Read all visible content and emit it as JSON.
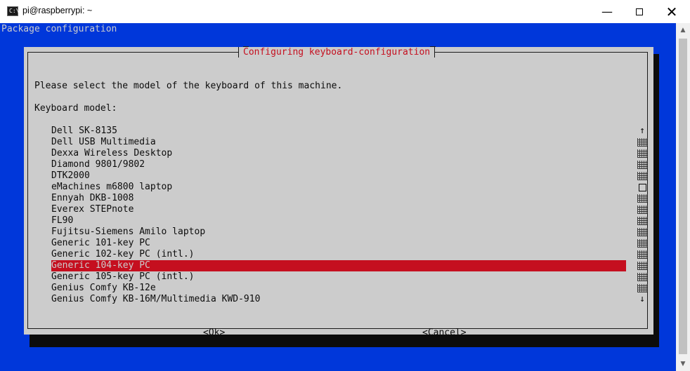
{
  "window": {
    "title": "pi@raspberrypi: ~",
    "app_icon_text": "C:\\",
    "buttons": {
      "minimize": "—",
      "close": "✕"
    }
  },
  "terminal": {
    "backtitle": "Package configuration",
    "dialog": {
      "title": "Configuring keyboard-configuration",
      "prompt": "Please select the model of the keyboard of this machine.",
      "label": "Keyboard model:",
      "items": [
        "Dell SK-8135",
        "Dell USB Multimedia",
        "Dexxa Wireless Desktop",
        "Diamond 9801/9802",
        "DTK2000",
        "eMachines m6800 laptop",
        "Ennyah DKB-1008",
        "Everex STEPnote",
        "FL90",
        "Fujitsu-Siemens Amilo laptop",
        "Generic 101-key PC",
        "Generic 102-key PC (intl.)",
        "Generic 104-key PC",
        "Generic 105-key PC (intl.)",
        "Genius Comfy KB-12e",
        "Genius Comfy KB-16M/Multimedia KWD-910"
      ],
      "selected": "Generic 104-key PC",
      "scroll_up": "↑",
      "scroll_down": "↓",
      "ok_label": "<Ok>",
      "cancel_label": "<Cancel>"
    }
  },
  "colors": {
    "terminal_bg": "#0037da",
    "dialog_bg": "#cccccc",
    "accent_red": "#c50f1f",
    "shadow": "#0c0c0c"
  },
  "icons": {
    "window_scroll_up": "scroll-up-arrow-icon",
    "window_scroll_down": "scroll-down-arrow-icon"
  }
}
